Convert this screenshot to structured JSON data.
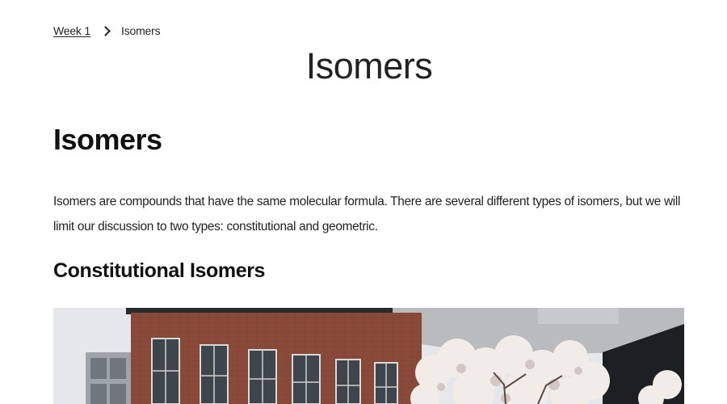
{
  "breadcrumb": {
    "parent_label": "Week 1",
    "current_label": "Isomers",
    "separator_icon": "chevron-right-icon"
  },
  "page": {
    "title": "Isomers"
  },
  "content": {
    "section_heading": "Isomers",
    "intro_paragraph": "Isomers are compounds that have the same molecular formula. There are several different types of isomers, but we will limit our discussion to two types: constitutional and geometric.",
    "sub_heading": "Constitutional Isomers"
  },
  "colors": {
    "text": "#111111",
    "background": "#ffffff",
    "brick": "#8a4a3a"
  }
}
